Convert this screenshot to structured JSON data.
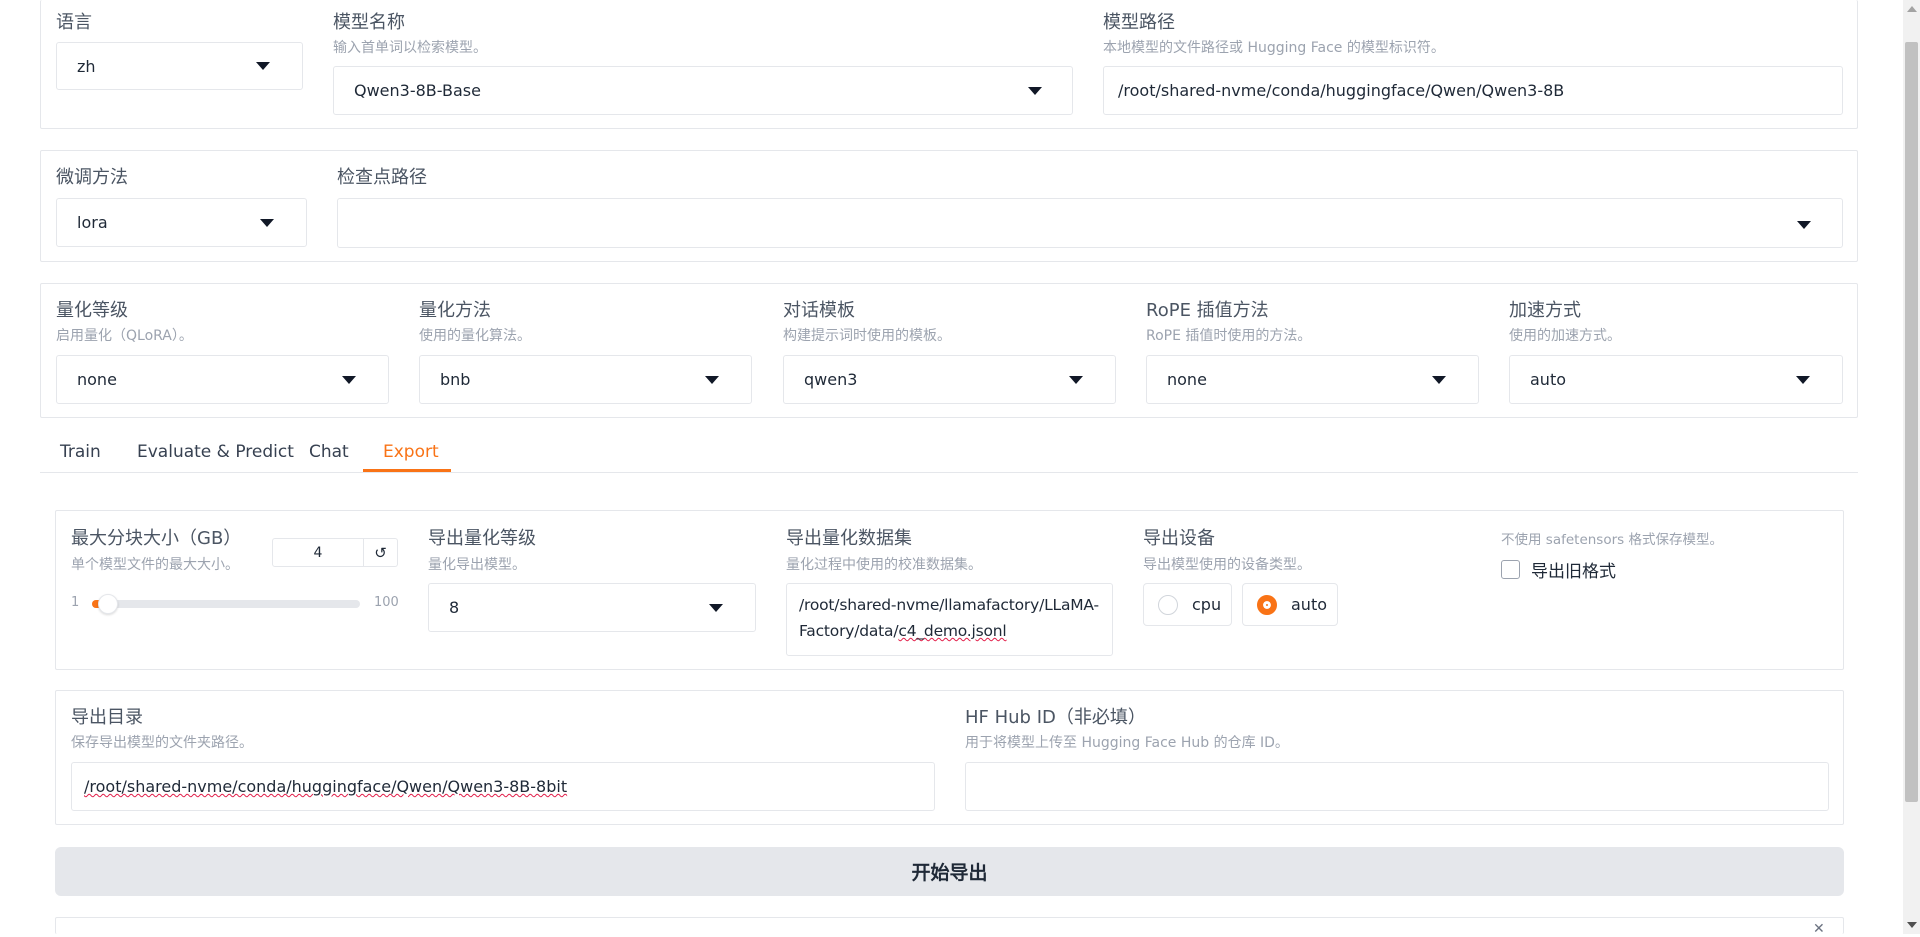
{
  "model_section": {
    "language": {
      "label": "语言",
      "value": "zh"
    },
    "model_name": {
      "label": "模型名称",
      "hint": "输入首单词以检索模型。",
      "value": "Qwen3-8B-Base"
    },
    "model_path": {
      "label": "模型路径",
      "hint": "本地模型的文件路径或 Hugging Face 的模型标识符。",
      "value": "/root/shared-nvme/conda/huggingface/Qwen/Qwen3-8B"
    }
  },
  "finetune_section": {
    "method": {
      "label": "微调方法",
      "value": "lora"
    },
    "checkpoint": {
      "label": "检查点路径",
      "value": ""
    }
  },
  "quant_section": {
    "quant_level": {
      "label": "量化等级",
      "hint": "启用量化（QLoRA）。",
      "value": "none"
    },
    "quant_method": {
      "label": "量化方法",
      "hint": "使用的量化算法。",
      "value": "bnb"
    },
    "template": {
      "label": "对话模板",
      "hint": "构建提示词时使用的模板。",
      "value": "qwen3"
    },
    "rope": {
      "label": "RoPE 插值方法",
      "hint": "RoPE 插值时使用的方法。",
      "value": "none"
    },
    "booster": {
      "label": "加速方式",
      "hint": "使用的加速方式。",
      "value": "auto"
    }
  },
  "tabs": [
    {
      "label": "Train"
    },
    {
      "label": "Evaluate & Predict"
    },
    {
      "label": "Chat"
    },
    {
      "label": "Export"
    }
  ],
  "export": {
    "shard_size": {
      "label": "最大分块大小（GB）",
      "hint": "单个模型文件的最大大小。",
      "value": "4",
      "min": "1",
      "max": "100",
      "reset_symbol": "↺"
    },
    "export_quant_bit": {
      "label": "导出量化等级",
      "hint": "量化导出模型。",
      "value": "8"
    },
    "export_quant_dataset": {
      "label": "导出量化数据集",
      "hint": "量化过程中使用的校准数据集。",
      "line1": "/root/shared-nvme/llamafactory/LLaMA-",
      "line2_a": "Factory/data/",
      "line2_b": "c4_demo.jsonl"
    },
    "export_device": {
      "label": "导出设备",
      "hint": "导出模型使用的设备类型。",
      "options": [
        "cpu",
        "auto"
      ],
      "selected": "auto"
    },
    "legacy_format": {
      "hint": "不使用 safetensors 格式保存模型。",
      "label": "导出旧格式",
      "checked": false
    },
    "export_dir": {
      "label": "导出目录",
      "hint": "保存导出模型的文件夹路径。",
      "value": "/root/shared-nvme/conda/huggingface/Qwen/Qwen3-8B-8bit"
    },
    "hub_id": {
      "label": "HF Hub ID（非必填）",
      "hint": "用于将模型上传至 Hugging Face Hub 的仓库 ID。",
      "value": ""
    },
    "start_button": "开始导出"
  },
  "colors": {
    "accent": "#f97316",
    "border": "#e5e7eb",
    "button_bg": "#e5e7eb"
  }
}
